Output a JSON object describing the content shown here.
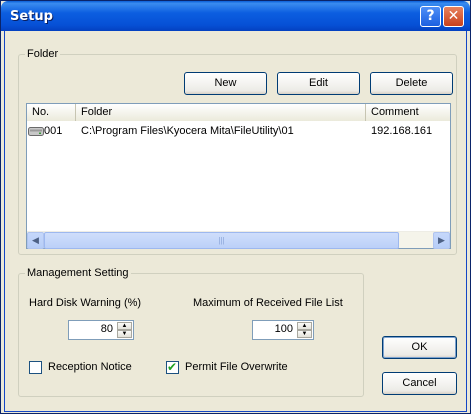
{
  "window": {
    "title": "Setup",
    "help_glyph": "?",
    "close_glyph": "✕"
  },
  "folder_group": {
    "label": "Folder",
    "new_label": "New",
    "edit_label": "Edit",
    "delete_label": "Delete",
    "columns": [
      "No.",
      "Folder",
      "Comment"
    ],
    "rows": [
      {
        "no": "001",
        "folder": "C:\\Program Files\\Kyocera Mita\\FileUtility\\01",
        "comment": "192.168.161"
      }
    ],
    "row_icon": "drive-icon",
    "scroll_left_glyph": "◀",
    "scroll_right_glyph": "▶",
    "thumb_grip": "|||"
  },
  "management_group": {
    "label": "Management Setting",
    "hdd_warning_label": "Hard Disk Warning (%)",
    "hdd_warning_value": "80",
    "max_files_label": "Maximum of Received File List",
    "max_files_value": "100",
    "reception_notice_label": "Reception Notice",
    "reception_notice_checked": false,
    "permit_overwrite_label": "Permit File Overwrite",
    "permit_overwrite_checked": true,
    "checkmark_glyph": "✔"
  },
  "buttons": {
    "ok_label": "OK",
    "cancel_label": "Cancel"
  },
  "spin_up_glyph": "▲",
  "spin_down_glyph": "▼",
  "colors": {
    "titlebar": "#0c5ee0",
    "dialog_bg": "#ece9d8",
    "list_border": "#7f9db9"
  }
}
